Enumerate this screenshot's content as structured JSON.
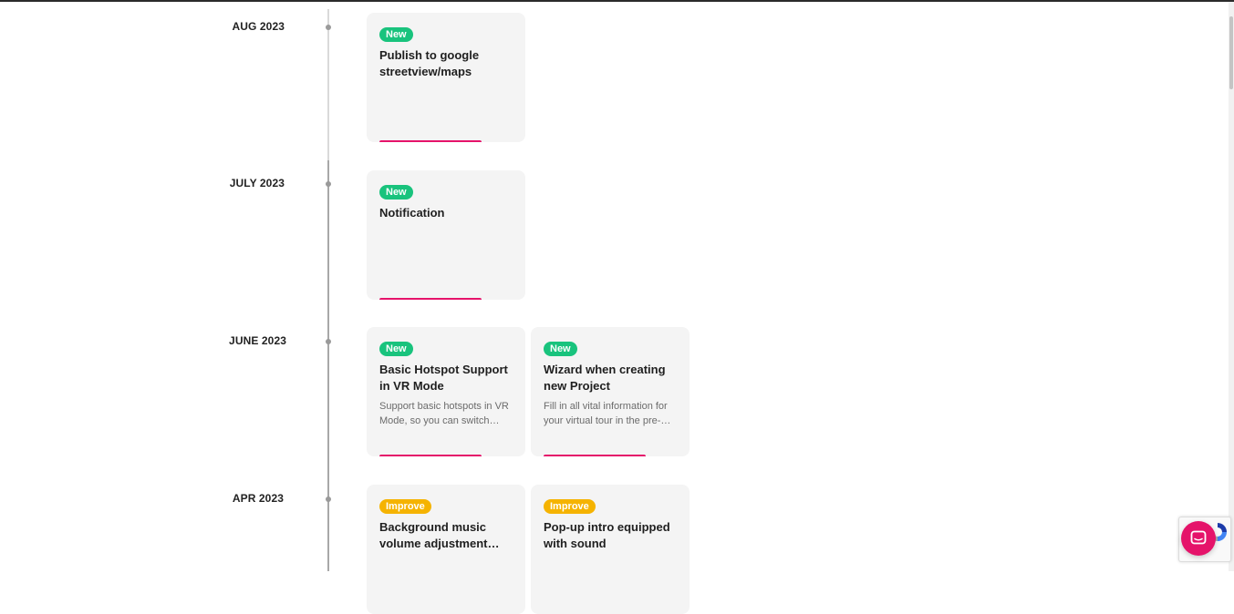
{
  "timeline": [
    {
      "month": "AUG 2023",
      "cards": [
        {
          "badge": "New",
          "badge_type": "new",
          "title": "Publish to google streetview/maps",
          "description": ""
        }
      ]
    },
    {
      "month": "JULY 2023",
      "cards": [
        {
          "badge": "New",
          "badge_type": "new",
          "title": "Notification",
          "description": ""
        }
      ]
    },
    {
      "month": "JUNE 2023",
      "cards": [
        {
          "badge": "New",
          "badge_type": "new",
          "title": "Basic Hotspot Support in VR Mode",
          "description": "Support basic hotspots in VR Mode, so you can switch between scenes"
        },
        {
          "badge": "New",
          "badge_type": "new",
          "title": "Wizard when creating new Project",
          "description": "Fill in all vital information for your virtual tour in the pre-creation wizard"
        }
      ]
    },
    {
      "month": "APR 2023",
      "cards": [
        {
          "badge": "Improve",
          "badge_type": "improve",
          "title": "Background music volume adjustment settings",
          "description": ""
        },
        {
          "badge": "Improve",
          "badge_type": "improve",
          "title": "Pop-up intro equipped with sound",
          "description": ""
        }
      ]
    }
  ],
  "colors": {
    "new_badge": "#19c37d",
    "improve_badge": "#f5b301",
    "accent": "#e5136a",
    "card_background": "#f4f4f4"
  },
  "icons": {
    "chat": "chat-bubble-icon",
    "recaptcha": "recaptcha-icon"
  }
}
